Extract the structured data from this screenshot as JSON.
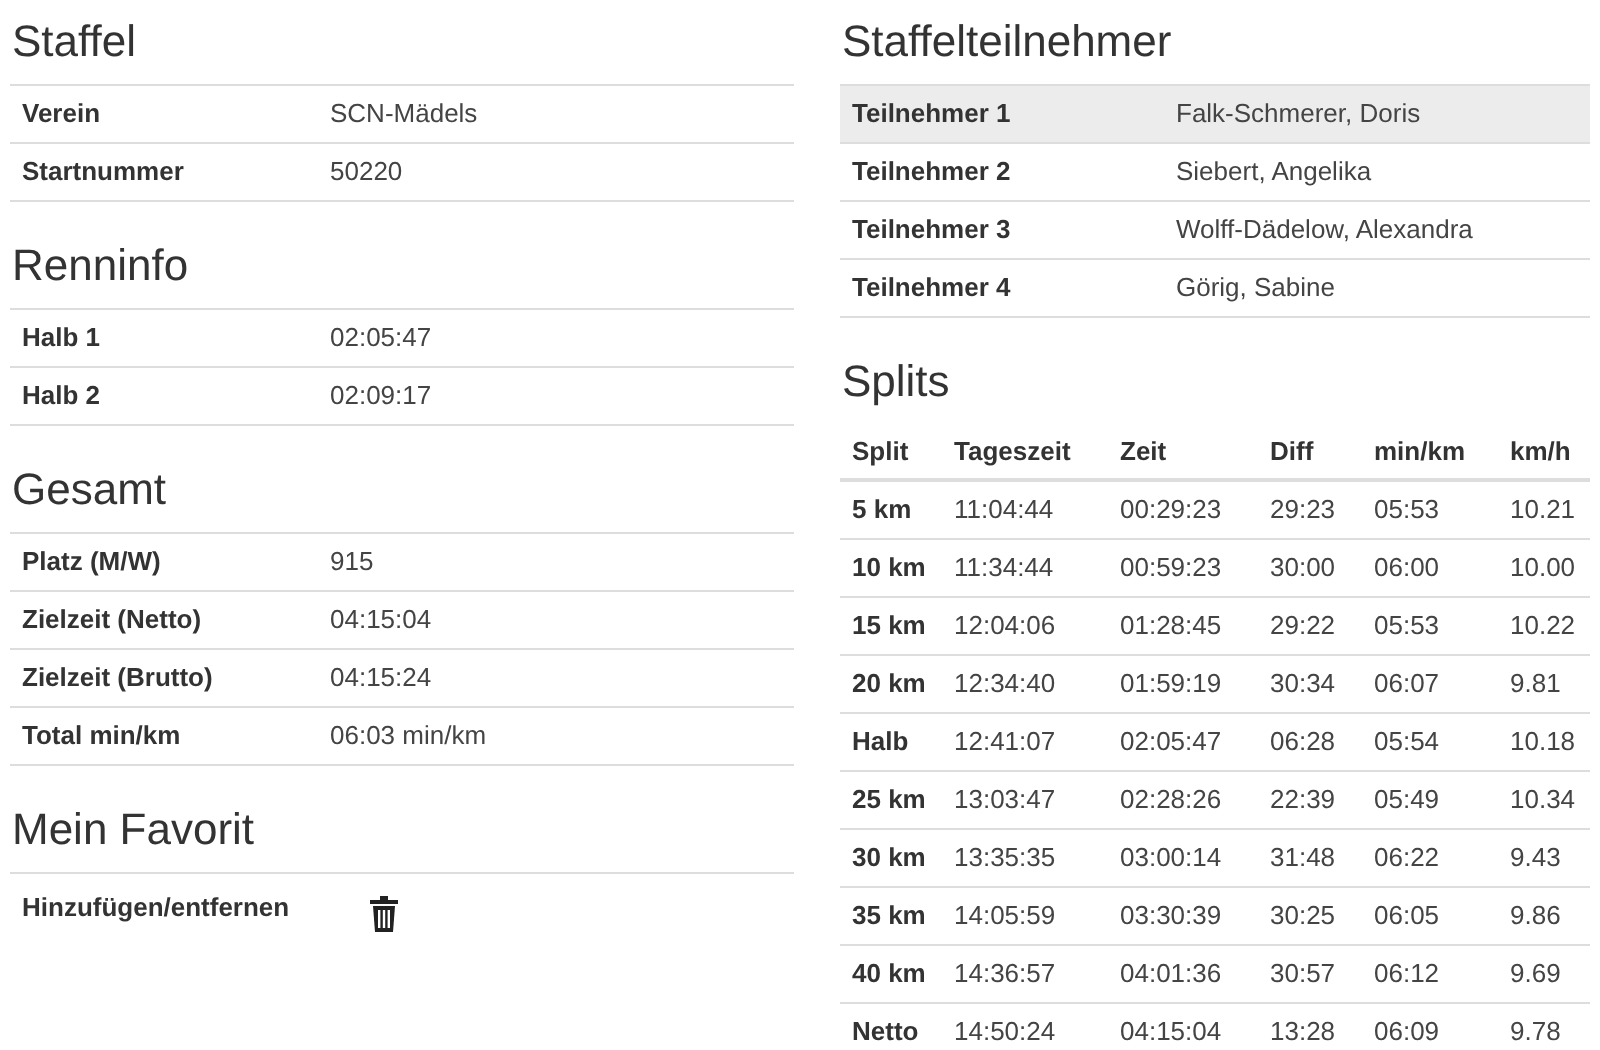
{
  "staffel": {
    "title": "Staffel",
    "rows": [
      {
        "label": "Verein",
        "value": "SCN-Mädels"
      },
      {
        "label": "Startnummer",
        "value": "50220"
      }
    ]
  },
  "renninfo": {
    "title": "Renninfo",
    "rows": [
      {
        "label": "Halb 1",
        "value": "02:05:47"
      },
      {
        "label": "Halb 2",
        "value": "02:09:17"
      }
    ]
  },
  "gesamt": {
    "title": "Gesamt",
    "rows": [
      {
        "label": "Platz (M/W)",
        "value": "915"
      },
      {
        "label": "Zielzeit (Netto)",
        "value": "04:15:04"
      },
      {
        "label": "Zielzeit (Brutto)",
        "value": "04:15:24"
      },
      {
        "label": "Total min/km",
        "value": "06:03 min/km"
      }
    ]
  },
  "favorit": {
    "title": "Mein Favorit",
    "label": "Hinzufügen/entfernen"
  },
  "teilnehmer": {
    "title": "Staffelteilnehmer",
    "rows": [
      {
        "label": "Teilnehmer 1",
        "value": "Falk-Schmerer, Doris",
        "hovered": true
      },
      {
        "label": "Teilnehmer 2",
        "value": "Siebert, Angelika",
        "hovered": false
      },
      {
        "label": "Teilnehmer 3",
        "value": "Wolff-Dädelow, Alexandra",
        "hovered": false
      },
      {
        "label": "Teilnehmer 4",
        "value": "Görig, Sabine",
        "hovered": false
      }
    ]
  },
  "splits": {
    "title": "Splits",
    "columns": [
      "Split",
      "Tageszeit",
      "Zeit",
      "Diff",
      "min/km",
      "km/h"
    ],
    "rows": [
      [
        "5 km",
        "11:04:44",
        "00:29:23",
        "29:23",
        "05:53",
        "10.21"
      ],
      [
        "10 km",
        "11:34:44",
        "00:59:23",
        "30:00",
        "06:00",
        "10.00"
      ],
      [
        "15 km",
        "12:04:06",
        "01:28:45",
        "29:22",
        "05:53",
        "10.22"
      ],
      [
        "20 km",
        "12:34:40",
        "01:59:19",
        "30:34",
        "06:07",
        "9.81"
      ],
      [
        "Halb",
        "12:41:07",
        "02:05:47",
        "06:28",
        "05:54",
        "10.18"
      ],
      [
        "25 km",
        "13:03:47",
        "02:28:26",
        "22:39",
        "05:49",
        "10.34"
      ],
      [
        "30 km",
        "13:35:35",
        "03:00:14",
        "31:48",
        "06:22",
        "9.43"
      ],
      [
        "35 km",
        "14:05:59",
        "03:30:39",
        "30:25",
        "06:05",
        "9.86"
      ],
      [
        "40 km",
        "14:36:57",
        "04:01:36",
        "30:57",
        "06:12",
        "9.69"
      ],
      [
        "Netto",
        "14:50:24",
        "04:15:04",
        "13:28",
        "06:09",
        "9.78"
      ]
    ]
  }
}
